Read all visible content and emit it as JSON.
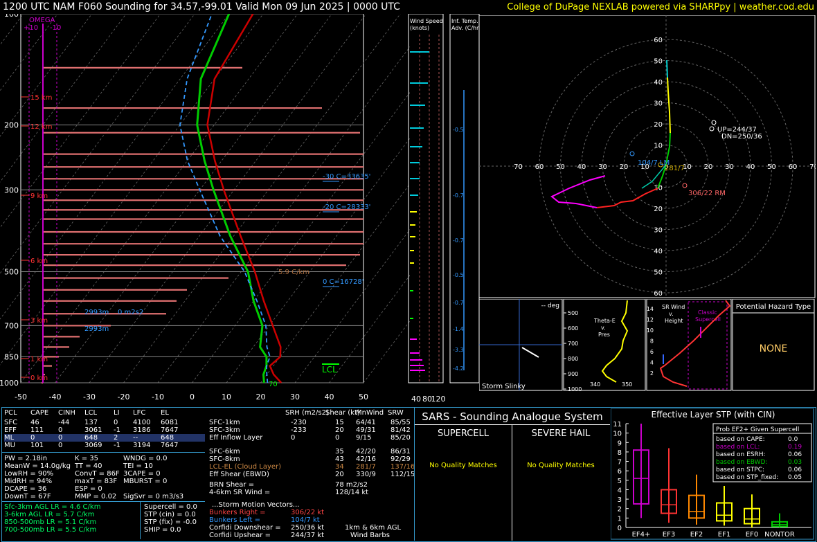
{
  "header": {
    "title": "1200 UTC NAM F060 Sounding for 34.57,-99.01 Valid  Mon 09 Jun 2025 | 0000 UTC",
    "credit": "College of DuPage NEXLAB powered via SHARPpy | weather.cod.edu"
  },
  "colors": {
    "temp": "#cc0000",
    "dewp": "#00cc00",
    "wetbulb": "#3399ff",
    "parcel": "#ffffff",
    "omega": "#cc00cc",
    "accent": "#ffff00"
  },
  "skewt": {
    "pressure_ticks": [
      "100",
      "200",
      "300",
      "500",
      "700",
      "850",
      "1000"
    ],
    "temp_ticks": [
      "-50",
      "-40",
      "-30",
      "-20",
      "-10",
      "0",
      "10",
      "20",
      "30",
      "40",
      "50"
    ],
    "omega_label": "OMEGA",
    "omega_scale": [
      "+10",
      "-10"
    ],
    "height_labels": [
      "15 km",
      "12 km",
      "9 km",
      "6 km",
      "3 km",
      "1 km",
      "0 km"
    ],
    "level_labels": [
      "-30 C=33635'",
      "-20 C=28333'",
      "0 C=16728'"
    ],
    "lapse_label": "5.9 C/km",
    "srh_labels": [
      "2993m",
      "0 m2s2",
      "2993m"
    ],
    "lcl_label": "LCL",
    "wb_label": "70",
    "wind_speed_title": "Wind Speed (knots)",
    "wind_speed_ticks": [
      "40",
      "80",
      "120"
    ],
    "inf_title": "Inf. Temp. Adv. (C/hr)",
    "inf_values": [
      "-0.5",
      "-0.7",
      "-0.7",
      "-0.5",
      "-0.7",
      "-1.4",
      "-3.3",
      "-4.2"
    ]
  },
  "chart_data": [
    {
      "type": "line",
      "title": "1200 UTC NAM F060 Sounding for 34.57,-99.01 Valid  Mon 09 Jun 2025 | 0000 UTC",
      "xlabel": "",
      "ylabel": "",
      "xlim": [
        -50,
        50
      ],
      "ylim": [
        1000,
        100
      ],
      "y_scale": "log-pressure",
      "series": [
        {
          "name": "",
          "values_desc": "temperature",
          "points": [
            [
              1000,
              26
            ],
            [
              950,
              22
            ],
            [
              900,
              19
            ],
            [
              850,
              20
            ],
            [
              800,
              18
            ],
            [
              700,
              11
            ],
            [
              600,
              3
            ],
            [
              500,
              -6
            ],
            [
              400,
              -18
            ],
            [
              300,
              -33
            ],
            [
              250,
              -42
            ],
            [
              200,
              -52
            ],
            [
              150,
              -60
            ],
            [
              100,
              -63
            ]
          ]
        },
        {
          "name": "",
          "values_desc": "dewpoint",
          "points": [
            [
              1000,
              21
            ],
            [
              950,
              19
            ],
            [
              900,
              18
            ],
            [
              850,
              16
            ],
            [
              800,
              12
            ],
            [
              700,
              8
            ],
            [
              600,
              0
            ],
            [
              500,
              -8
            ],
            [
              400,
              -21
            ],
            [
              300,
              -36
            ],
            [
              250,
              -45
            ],
            [
              200,
              -55
            ],
            [
              150,
              -64
            ],
            [
              100,
              -70
            ]
          ]
        },
        {
          "name": "",
          "values_desc": "wetbulb",
          "points": [
            [
              1000,
              22
            ],
            [
              950,
              20
            ],
            [
              900,
              18
            ],
            [
              850,
              17
            ],
            [
              800,
              14
            ],
            [
              700,
              9
            ],
            [
              600,
              1
            ],
            [
              500,
              -9
            ],
            [
              400,
              -24
            ],
            [
              300,
              -40
            ],
            [
              250,
              -50
            ],
            [
              200,
              -60
            ],
            [
              150,
              -68
            ],
            [
              100,
              -75
            ]
          ]
        }
      ],
      "ticks_y": [
        "100",
        "200",
        "300",
        "500",
        "700",
        "850",
        "1000"
      ],
      "ticks_x": [
        "-50",
        "-40",
        "-30",
        "-20",
        "-10",
        "0",
        "10",
        "20",
        "30",
        "40",
        "50"
      ]
    },
    {
      "type": "scatter",
      "title": "",
      "xlim": [
        -70,
        70
      ],
      "ylim": [
        -70,
        70
      ],
      "rings": [
        10,
        20,
        30,
        40,
        50,
        60
      ],
      "hodograph": [
        [
          -2,
          -5
        ],
        [
          5,
          -4
        ],
        [
          15,
          -8
        ],
        [
          22,
          -14
        ],
        [
          30,
          -18
        ],
        [
          40,
          -17
        ],
        [
          50,
          -15
        ],
        [
          56,
          -11
        ],
        [
          50,
          -8
        ],
        [
          44,
          -6
        ],
        [
          35,
          -3
        ],
        [
          28,
          -1
        ],
        [
          22,
          0
        ],
        [
          18,
          2
        ],
        [
          15,
          5
        ],
        [
          12,
          8
        ],
        [
          8,
          14
        ],
        [
          5,
          20
        ],
        [
          3,
          28
        ],
        [
          2,
          35
        ],
        [
          2,
          41
        ],
        [
          3,
          48
        ]
      ],
      "markers": [
        {
          "label": "UP=244/37",
          "x": -33,
          "y": -14
        },
        {
          "label": "DN=250/36",
          "x": -33,
          "y": -17
        },
        {
          "label": "104/7 LM",
          "x": 7,
          "y": -2
        },
        {
          "label": "281/7",
          "x": -7,
          "y": -2
        },
        {
          "label": "306/22 RM",
          "x": -18,
          "y": -13
        }
      ]
    },
    {
      "type": "bar",
      "title": "Effective Layer STP (with CIN)",
      "categories": [
        "EF4+",
        "EF3",
        "EF2",
        "EF1",
        "EF0",
        "NONTOR"
      ],
      "boxes": [
        {
          "min": 1.0,
          "q1": 2.5,
          "median": 5.2,
          "q3": 8.2,
          "max": 11.0,
          "color": "#cc00cc"
        },
        {
          "min": 0.5,
          "q1": 1.5,
          "median": 2.4,
          "q3": 4.0,
          "max": 8.4,
          "color": "#ff3333"
        },
        {
          "min": 0.3,
          "q1": 1.0,
          "median": 1.7,
          "q3": 3.4,
          "max": 5.6,
          "color": "#ff8800"
        },
        {
          "min": 0.2,
          "q1": 0.7,
          "median": 1.3,
          "q3": 2.6,
          "max": 4.4,
          "color": "#ffff00"
        },
        {
          "min": 0.0,
          "q1": 0.4,
          "median": 0.9,
          "q3": 2.0,
          "max": 3.5,
          "color": "#ffff00"
        },
        {
          "min": 0.0,
          "q1": 0.1,
          "median": 0.3,
          "q3": 0.6,
          "max": 1.5,
          "color": "#00cc00"
        }
      ],
      "ylim": [
        0,
        11
      ],
      "ticks": [
        "0",
        "1",
        "2",
        "3",
        "4",
        "5",
        "6",
        "7",
        "8",
        "9",
        "10",
        "11"
      ]
    }
  ],
  "hodo_ticks": {
    "x": [
      "70",
      "60",
      "50",
      "40",
      "30",
      "20",
      "10",
      "0",
      "10",
      "20",
      "30",
      "40",
      "50",
      "60",
      "70"
    ],
    "y": [
      "60",
      "50",
      "40",
      "30",
      "20",
      "10",
      "10",
      "20",
      "30",
      "40",
      "50",
      "60"
    ]
  },
  "slinky": {
    "deg": "-- deg",
    "label": "Storm Slinky"
  },
  "theta": {
    "label": "Theta-E v. Pres",
    "ticks": [
      "500",
      "600",
      "700",
      "800",
      "900",
      "1000"
    ],
    "xt": [
      "340",
      "350"
    ]
  },
  "srwind": {
    "label": "SR Wind v. Height",
    "ticks": [
      "14",
      "12",
      "10",
      "8",
      "6",
      "4",
      "2"
    ],
    "classic": "Classic Supercell"
  },
  "hazard": {
    "title": "Potential Hazard Type",
    "value": "NONE"
  },
  "parcels": {
    "headers": [
      "PCL",
      "CAPE",
      "CINH",
      "LCL",
      "LI",
      "LFC",
      "EL"
    ],
    "rows": [
      [
        "SFC",
        "46",
        "-44",
        "137",
        "0",
        "4100",
        "6081"
      ],
      [
        "EFF",
        "111",
        "0",
        "3061",
        "-1",
        "3186",
        "7647"
      ],
      [
        "ML",
        "0",
        "0",
        "648",
        "2",
        "--",
        "648"
      ],
      [
        "MU",
        "101",
        "0",
        "3069",
        "-1",
        "3194",
        "7647"
      ]
    ],
    "indices_left": [
      "PW = 2.18in",
      "MeanW = 14.0g/kg",
      "LowRH = 90%",
      "MidRH = 94%",
      "DCAPE = 36",
      "DownT = 67F"
    ],
    "indices_mid": [
      "K = 35",
      "TT = 40",
      "ConvT = 86F",
      "maxT = 83F",
      "ESP = 0",
      "MMP = 0.02"
    ],
    "indices_right": [
      "WNDG = 0.0",
      "TEI = 10",
      "3CAPE = 0",
      "MBURST = 0",
      "",
      "SigSvr = 0 m3/s3"
    ],
    "lapse": [
      "Sfc-3km AGL LR = 4.6 C/km",
      "3-6km AGL LR = 5.7 C/km",
      "850-500mb LR = 5.1 C/km",
      "700-500mb LR = 5.5 C/km"
    ],
    "comp": [
      "Supercell = 0.0",
      "STP (cin) = 0.0",
      "STP (fix) = -0.0",
      "SHIP = 0.0"
    ]
  },
  "kinematics": {
    "headers": [
      "SRH (m2/s2)",
      "Shear (kt)",
      "MnWind",
      "SRW"
    ],
    "rows": [
      [
        "SFC-1km",
        "-230",
        "15",
        "64/41",
        "85/55"
      ],
      [
        "SFC-3km",
        "-233",
        "20",
        "49/31",
        "81/42"
      ],
      [
        "Eff Inflow Layer",
        "0",
        "0",
        "9/15",
        "85/20"
      ],
      [
        "SFC-6km",
        "",
        "35",
        "42/20",
        "86/31"
      ],
      [
        "SFC-8km",
        "",
        "43",
        "42/16",
        "92/29"
      ],
      [
        "LCL-EL (Cloud Layer)",
        "",
        "34",
        "281/7",
        "137/16"
      ],
      [
        "Eff Shear (EBWD)",
        "",
        "20",
        "330/9",
        "112/15"
      ]
    ],
    "brn": [
      "BRN Shear =",
      "78 m2/s2"
    ],
    "sr46": [
      "4-6km SR Wind =",
      "128/14 kt"
    ],
    "motion_title": "...Storm Motion Vectors...",
    "motion": [
      [
        "Bunkers Right =",
        "306/22 kt"
      ],
      [
        "Bunkers Left =",
        "104/7 kt"
      ],
      [
        "Corfidi Downshear =",
        "250/36 kt"
      ],
      [
        "Corfidi Upshear =",
        "244/37 kt"
      ]
    ],
    "barb_label": "1km & 6km AGL Wind Barbs"
  },
  "sars": {
    "title": "SARS - Sounding Analogue System",
    "supercell": "SUPERCELL",
    "hail": "SEVERE HAIL",
    "no_match": "No Quality Matches"
  },
  "stp": {
    "prob_title": "Prob EF2+ Given Supercell",
    "rows": [
      [
        "based on CAPE:",
        "0.0"
      ],
      [
        "based on LCL:",
        "0.19"
      ],
      [
        "based on ESRH:",
        "0.06"
      ],
      [
        "based on EBWD:",
        "0.03"
      ],
      [
        "based on STPC:",
        "0.06"
      ],
      [
        "based on STP_fixed:",
        "0.05"
      ]
    ]
  }
}
